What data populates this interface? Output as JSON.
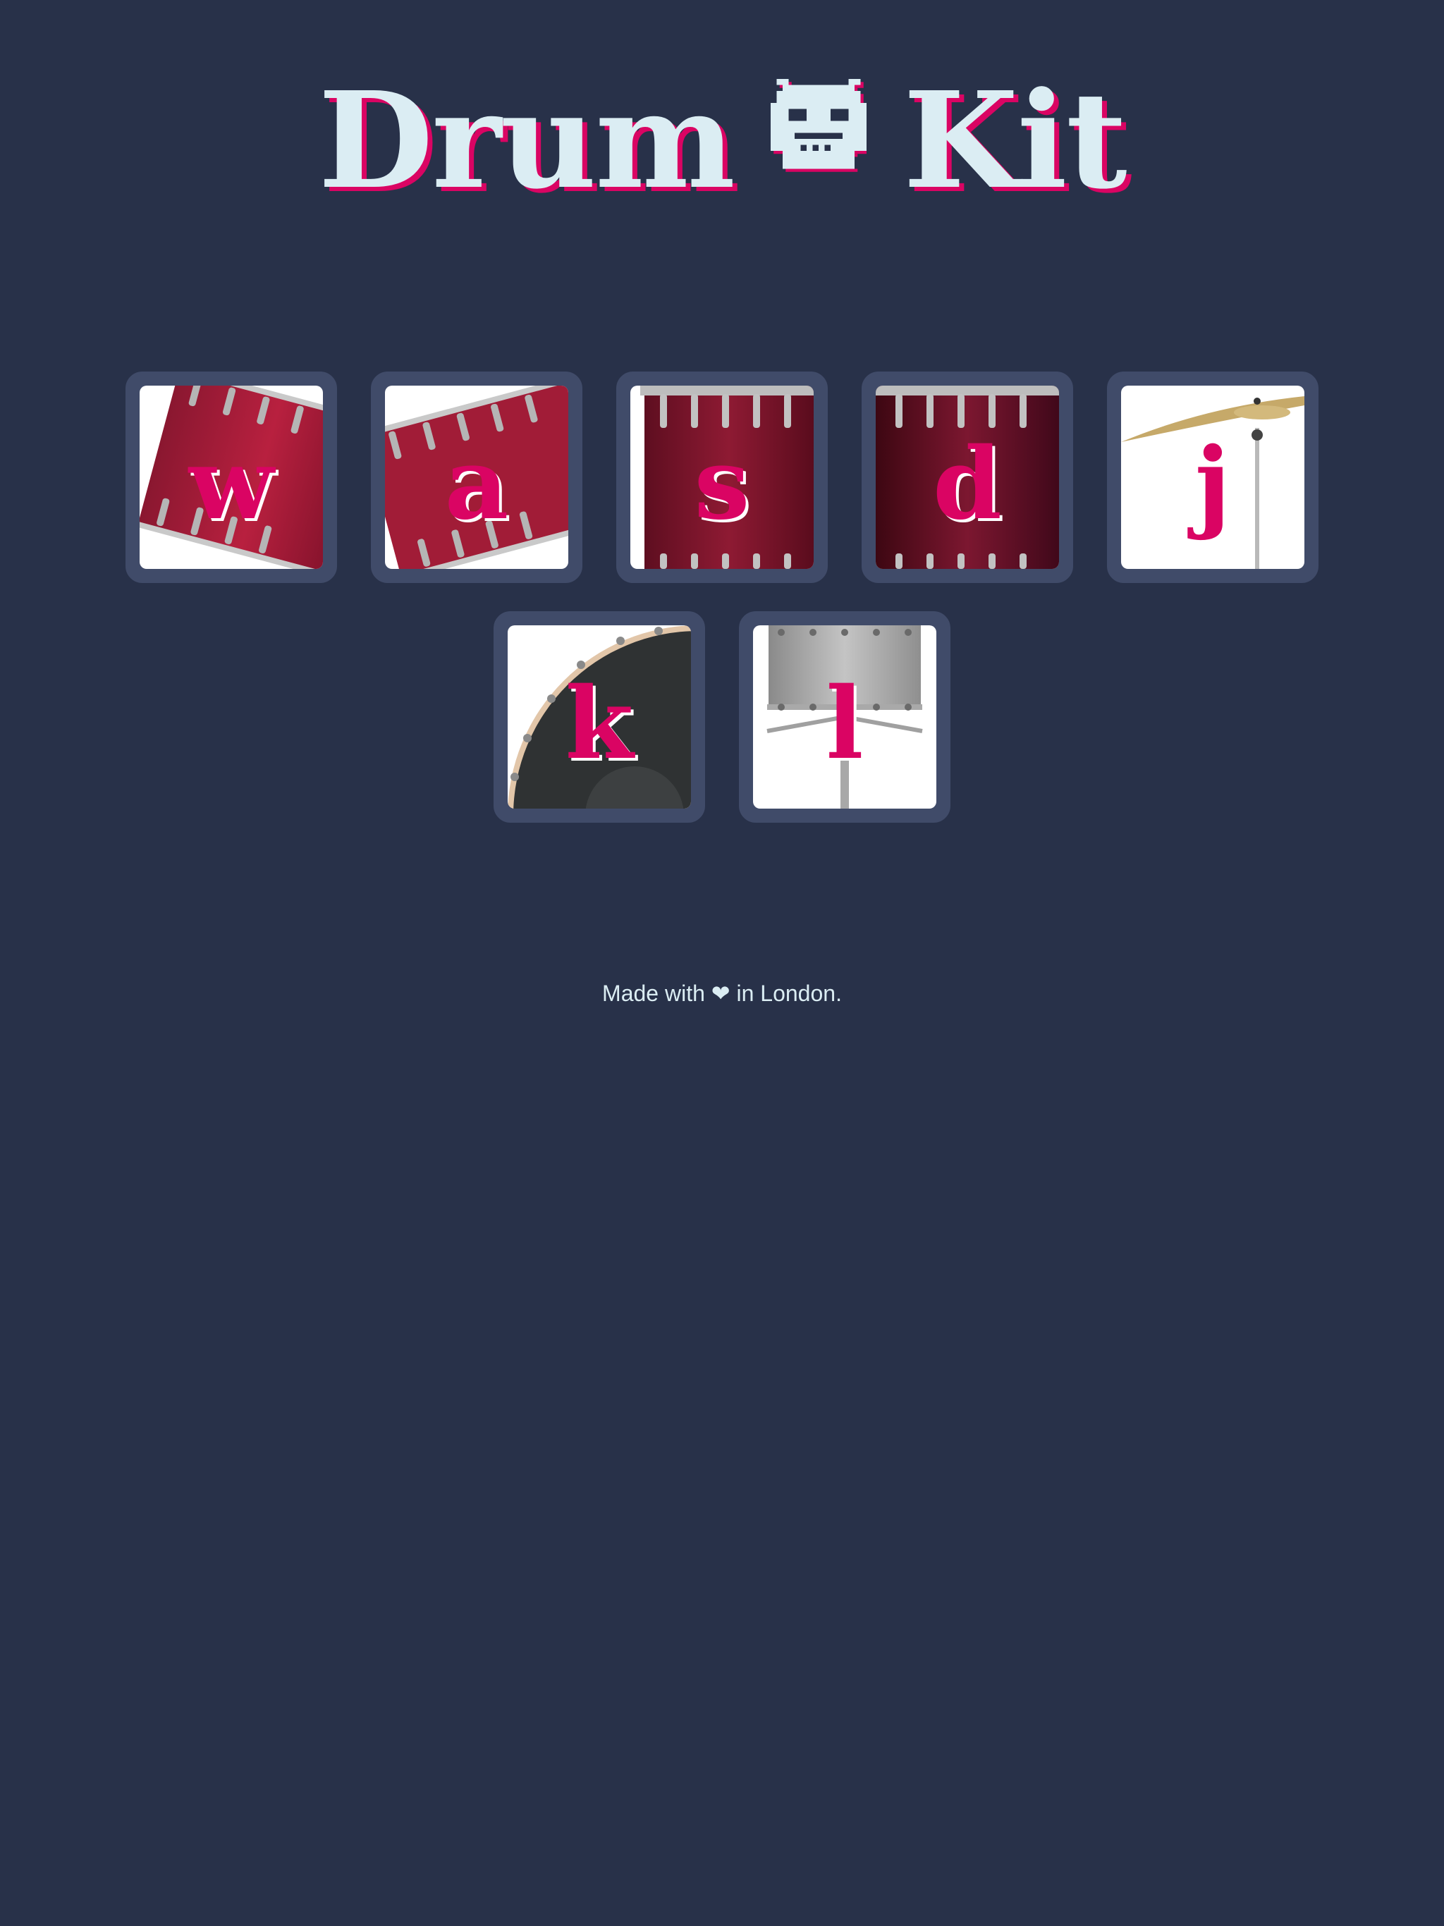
{
  "header": {
    "title_left": "Drum",
    "title_right": "Kit",
    "emoji_icon": "robot-face-icon"
  },
  "keys": [
    {
      "letter": "w",
      "instrument": "tom-drum-tilted-left-icon"
    },
    {
      "letter": "a",
      "instrument": "tom-drum-tilted-right-icon"
    },
    {
      "letter": "s",
      "instrument": "floor-tom-icon"
    },
    {
      "letter": "d",
      "instrument": "floor-tom-dark-icon"
    },
    {
      "letter": "j",
      "instrument": "cymbal-icon"
    },
    {
      "letter": "k",
      "instrument": "bass-drum-icon"
    },
    {
      "letter": "l",
      "instrument": "snare-drum-icon"
    }
  ],
  "footer": {
    "text_before": "Made with",
    "heart": "❤",
    "text_after": "in London."
  },
  "colors": {
    "background": "#283149",
    "key_border": "#404b69",
    "accent": "#da0463",
    "text": "#dbedf3"
  }
}
